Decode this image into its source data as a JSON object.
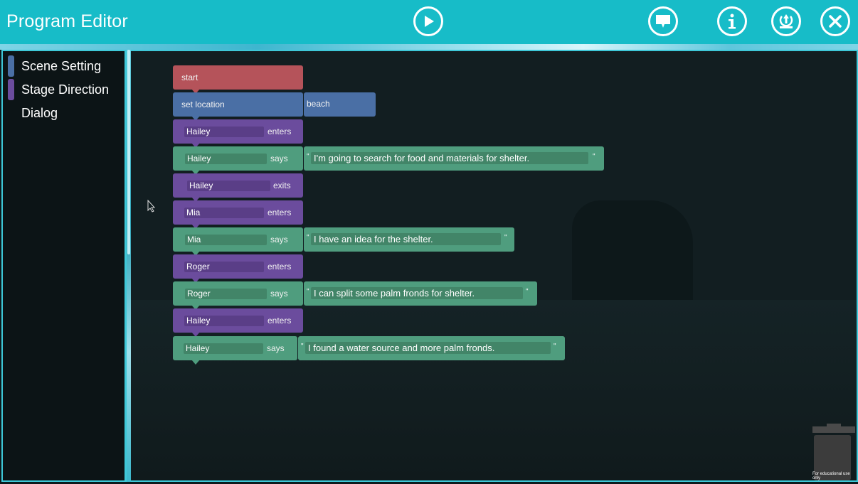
{
  "header": {
    "title": "Program Editor",
    "play_icon": "play-icon",
    "comment_icon": "speech-bubble-icon",
    "info_icon": "info-icon",
    "save_icon": "save-upload-icon",
    "close_icon": "close-icon"
  },
  "sidebar": {
    "items": [
      {
        "label": "Scene Setting",
        "color": "#4a6fa5"
      },
      {
        "label": "Stage Direction",
        "color": "#6b4c9d"
      },
      {
        "label": "Dialog",
        "color": ""
      }
    ]
  },
  "program": {
    "start": "start",
    "set_location": {
      "label": "set location",
      "value": "beach"
    },
    "verbs": {
      "enters": "enters",
      "says": "says",
      "exits": "exits"
    },
    "steps": [
      {
        "character": "Hailey",
        "action": "enters"
      },
      {
        "character": "Hailey",
        "action": "says",
        "line": "I'm going to search for food and materials for shelter."
      },
      {
        "character": "Hailey",
        "action": "exits"
      },
      {
        "character": "Mia",
        "action": "enters"
      },
      {
        "character": "Mia",
        "action": "says",
        "line": "I have an idea for the shelter."
      },
      {
        "character": "Roger",
        "action": "enters"
      },
      {
        "character": "Roger",
        "action": "says",
        "line": "I can split some palm fronds for shelter."
      },
      {
        "character": "Hailey",
        "action": "enters"
      },
      {
        "character": "Hailey",
        "action": "says",
        "line": "I found a water source and more palm fronds."
      }
    ]
  },
  "colors": {
    "header": "#17bcc8",
    "start": "#b5535a",
    "scene_setting": "#4a6fa5",
    "stage_direction": "#6b4c9d",
    "dialog": "#4f9d7e"
  },
  "footer": {
    "trash_icon": "trash-can-icon",
    "watermark": "For educational use only"
  }
}
